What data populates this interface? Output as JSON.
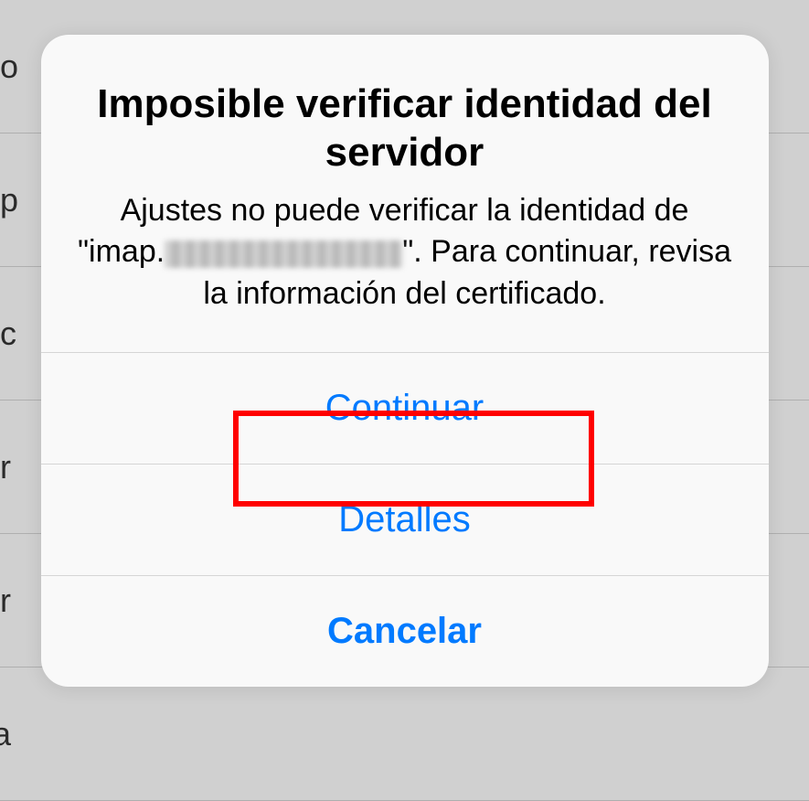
{
  "background": {
    "rows": [
      "eo",
      "rip",
      "oc",
      "or",
      "or",
      "ra"
    ]
  },
  "alert": {
    "title": "Imposible verificar identidad del servidor",
    "message_before": "Ajustes no puede verificar la identidad de \"imap.",
    "message_after": "\". Para continuar, revisa la información del certificado.",
    "continue_label": "Continuar",
    "details_label": "Detalles",
    "cancel_label": "Cancelar"
  }
}
